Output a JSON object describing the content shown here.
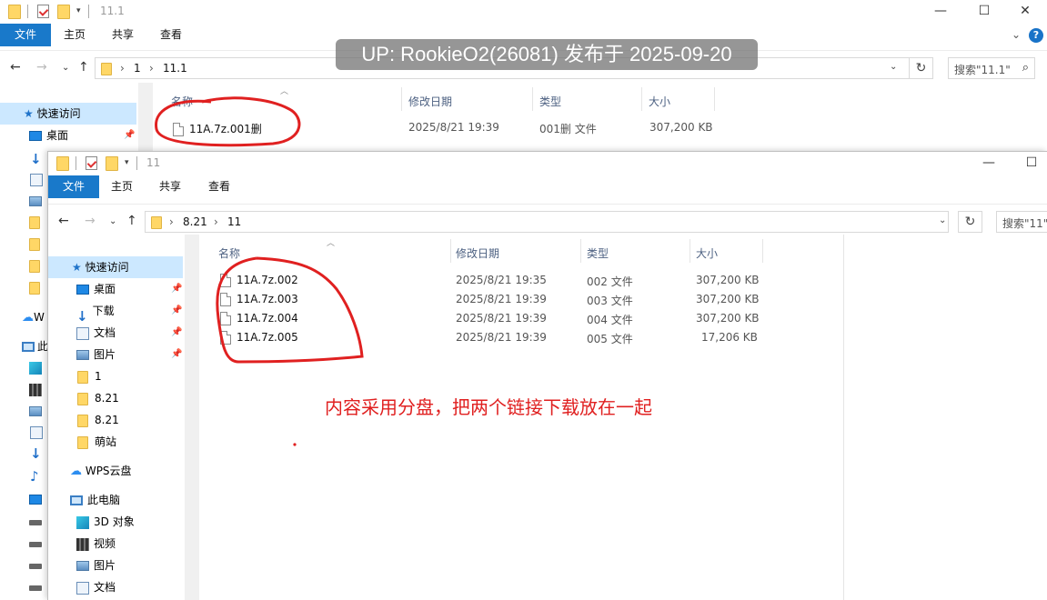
{
  "watermark": "UP: RookieO2(26081) 发布于 2025-09-20",
  "annotation": "内容采用分盘，把两个链接下载放在一起",
  "back_window": {
    "title": "11.1",
    "ribbon_tabs": [
      "文件",
      "主页",
      "共享",
      "查看"
    ],
    "breadcrumb": [
      "1",
      "11.1"
    ],
    "search_placeholder": "搜索\"11.1\"",
    "columns": [
      "名称",
      "修改日期",
      "类型",
      "大小"
    ],
    "files": [
      {
        "name": "11A.7z.001删",
        "date": "2025/8/21 19:39",
        "type": "001删 文件",
        "size": "307,200 KB"
      }
    ],
    "nav": {
      "quick_access": "快速访问",
      "desktop": "桌面",
      "partial_w": "W",
      "partial_pc": "此"
    }
  },
  "front_window": {
    "title": "11",
    "ribbon_tabs": [
      "文件",
      "主页",
      "共享",
      "查看"
    ],
    "breadcrumb": [
      "8.21",
      "11"
    ],
    "search_placeholder": "搜索\"11\"",
    "columns": [
      "名称",
      "修改日期",
      "类型",
      "大小"
    ],
    "files": [
      {
        "name": "11A.7z.002",
        "date": "2025/8/21 19:35",
        "type": "002 文件",
        "size": "307,200 KB"
      },
      {
        "name": "11A.7z.003",
        "date": "2025/8/21 19:39",
        "type": "003 文件",
        "size": "307,200 KB"
      },
      {
        "name": "11A.7z.004",
        "date": "2025/8/21 19:39",
        "type": "004 文件",
        "size": "307,200 KB"
      },
      {
        "name": "11A.7z.005",
        "date": "2025/8/21 19:39",
        "type": "005 文件",
        "size": "17,206 KB"
      }
    ],
    "nav": {
      "quick_access": "快速访问",
      "pinned": [
        "桌面",
        "下载",
        "文档",
        "图片"
      ],
      "folders": [
        "1",
        "8.21",
        "8.21",
        "萌站"
      ],
      "wps": "WPS云盘",
      "this_pc": "此电脑",
      "pc_items": [
        "3D 对象",
        "视频",
        "图片",
        "文档"
      ]
    }
  },
  "icons": {
    "folder": "folder-icon",
    "check": "properties-icon",
    "back": "back-arrow-icon",
    "forward": "forward-arrow-icon",
    "up": "up-arrow-icon",
    "refresh": "refresh-icon",
    "search": "search-icon",
    "help": "help-icon",
    "pin": "pin-icon",
    "file": "file-icon"
  },
  "colors": {
    "accent": "#1979ca",
    "selection": "#cce8ff",
    "annotation": "#e02020"
  }
}
